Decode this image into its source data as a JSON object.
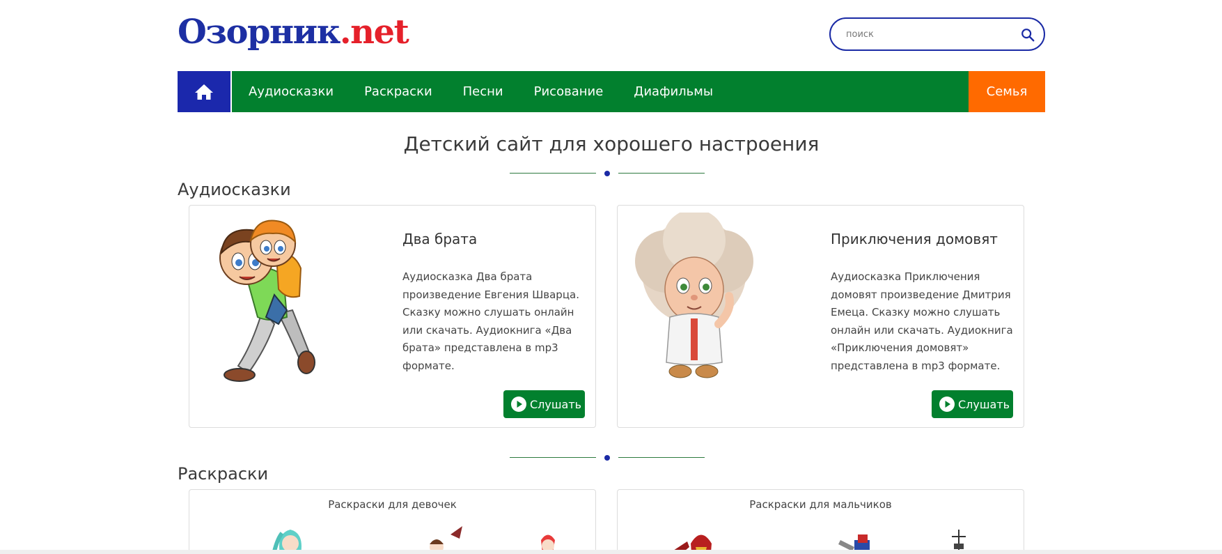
{
  "header": {
    "logo_part1": "Озорник",
    "logo_part2": ".net",
    "search_placeholder": "поиск"
  },
  "nav": {
    "home_icon": "home-icon",
    "items": [
      "Аудиосказки",
      "Раскраски",
      "Песни",
      "Рисование",
      "Диафильмы"
    ],
    "family": "Семья"
  },
  "colors": {
    "brand_blue": "#1b28ac",
    "nav_green": "#02802e",
    "family_orange": "#ff6a00",
    "logo_red": "#e5202a"
  },
  "main": {
    "title": "Детский сайт для хорошего настроения",
    "audio_section": "Аудиосказки",
    "coloring_section": "Раскраски"
  },
  "audio": [
    {
      "title": "Два брата",
      "description": "Аудиосказка Два брата произведение Евгения Шварца. Сказку можно слушать онлайн или скачать. Аудиокнига «Два брата» представлена в mp3 формате.",
      "button": "Слушать"
    },
    {
      "title": "Приключения домовят",
      "description": "Аудиосказка Приключения домовят произведение Дмитрия Емеца. Сказку можно слушать онлайн или скачать. Аудиокнига «Приключения домовят» представлена в mp3 формате.",
      "button": "Слушать"
    }
  ],
  "coloring": [
    {
      "title": "Раскраски для девочек"
    },
    {
      "title": "Раскраски для мальчиков"
    }
  ]
}
